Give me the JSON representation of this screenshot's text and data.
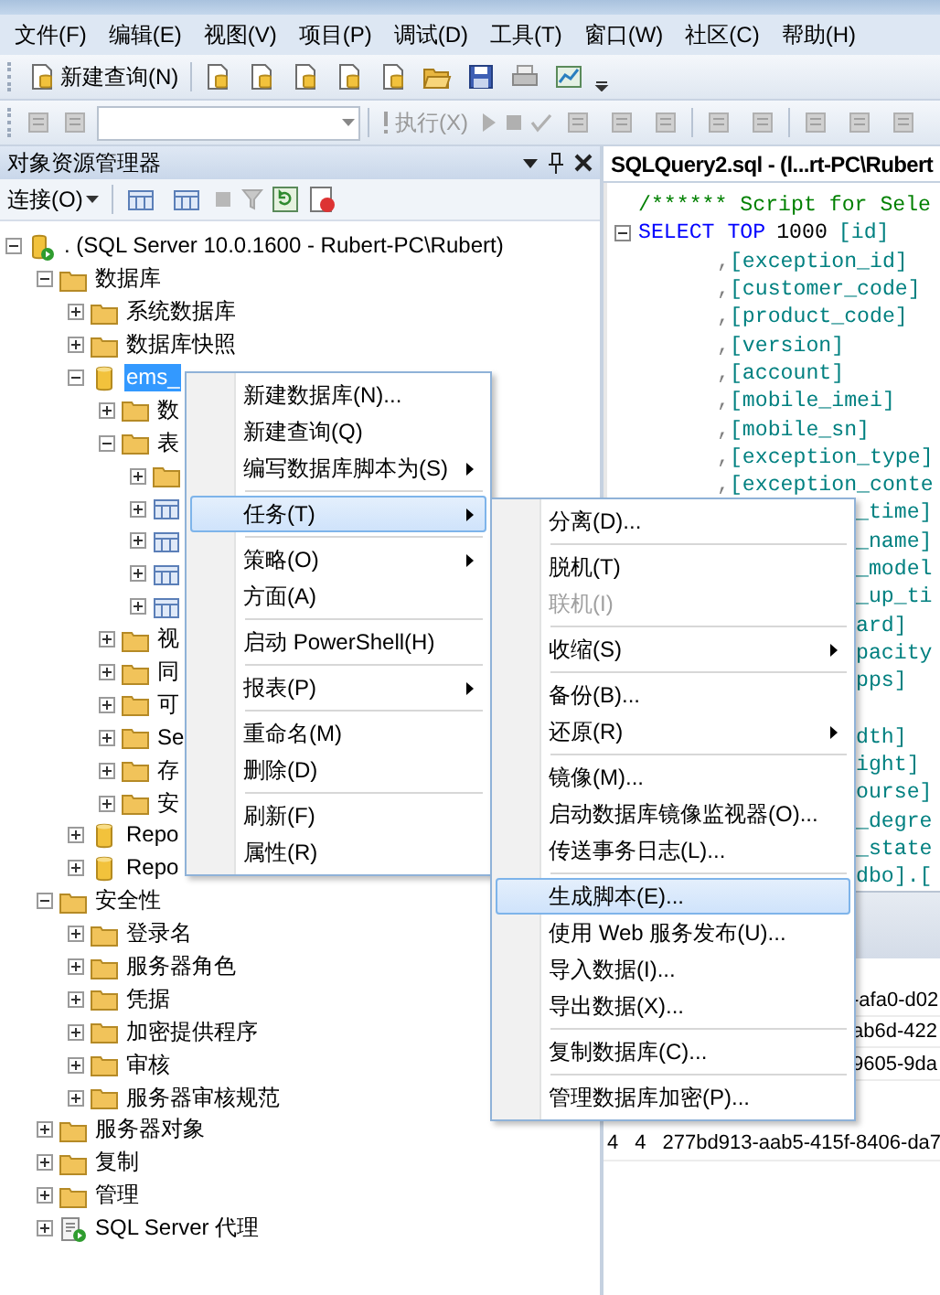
{
  "menu_bar": [
    "文件(F)",
    "编辑(E)",
    "视图(V)",
    "项目(P)",
    "调试(D)",
    "工具(T)",
    "窗口(W)",
    "社区(C)",
    "帮助(H)"
  ],
  "toolbar": {
    "new_query": "新建查询(N)"
  },
  "query_toolbar": {
    "execute": "执行(X)"
  },
  "object_explorer": {
    "title": "对象资源管理器",
    "connect": "连接(O)",
    "tree": [
      {
        "label": ". (SQL Server 10.0.1600 - Rubert-PC\\Rubert)",
        "kind": "server",
        "expanded": true,
        "selected": false,
        "children": [
          {
            "label": "数据库",
            "kind": "folder",
            "expanded": true,
            "selected": false,
            "children": [
              {
                "label": "系统数据库",
                "kind": "folder",
                "expanded": false,
                "selected": false
              },
              {
                "label": "数据库快照",
                "kind": "folder",
                "expanded": false,
                "selected": false
              },
              {
                "label": "ems_",
                "kind": "database",
                "expanded": true,
                "selected": true,
                "children": [
                  {
                    "label": "数",
                    "kind": "folder",
                    "expanded": false,
                    "selected": false
                  },
                  {
                    "label": "表",
                    "kind": "folder",
                    "expanded": true,
                    "selected": false,
                    "children": [
                      {
                        "kind": "folder",
                        "expanded": false
                      },
                      {
                        "kind": "table",
                        "expanded": false
                      },
                      {
                        "kind": "table",
                        "expanded": false
                      },
                      {
                        "kind": "table",
                        "expanded": false
                      },
                      {
                        "kind": "table",
                        "expanded": false
                      }
                    ]
                  },
                  {
                    "label": "视",
                    "kind": "folder",
                    "expanded": false,
                    "selected": false
                  },
                  {
                    "label": "同",
                    "kind": "folder",
                    "expanded": false,
                    "selected": false
                  },
                  {
                    "label": "可",
                    "kind": "folder",
                    "expanded": false,
                    "selected": false
                  },
                  {
                    "label": "Se",
                    "kind": "folder",
                    "expanded": false,
                    "selected": false
                  },
                  {
                    "label": "存",
                    "kind": "folder",
                    "expanded": false,
                    "selected": false
                  },
                  {
                    "label": "安",
                    "kind": "folder",
                    "expanded": false,
                    "selected": false
                  }
                ]
              },
              {
                "label": "Repo",
                "kind": "database",
                "expanded": false,
                "selected": false
              },
              {
                "label": "Repo",
                "kind": "database",
                "expanded": false,
                "selected": false
              }
            ]
          },
          {
            "label": "安全性",
            "kind": "folder",
            "expanded": true,
            "selected": false,
            "children": [
              {
                "label": "登录名",
                "kind": "folder",
                "expanded": false,
                "selected": false
              },
              {
                "label": "服务器角色",
                "kind": "folder",
                "expanded": false,
                "selected": false
              },
              {
                "label": "凭据",
                "kind": "folder",
                "expanded": false,
                "selected": false
              },
              {
                "label": "加密提供程序",
                "kind": "folder",
                "expanded": false,
                "selected": false
              },
              {
                "label": "审核",
                "kind": "folder",
                "expanded": false,
                "selected": false
              },
              {
                "label": "服务器审核规范",
                "kind": "folder",
                "expanded": false,
                "selected": false
              }
            ]
          },
          {
            "label": "服务器对象",
            "kind": "folder",
            "expanded": false,
            "selected": false
          },
          {
            "label": "复制",
            "kind": "folder",
            "expanded": false,
            "selected": false
          },
          {
            "label": "管理",
            "kind": "folder",
            "expanded": false,
            "selected": false
          },
          {
            "label": "SQL Server 代理",
            "kind": "agent",
            "expanded": false,
            "selected": false
          }
        ]
      }
    ]
  },
  "editor": {
    "tab": "SQLQuery2.sql - (l...rt-PC\\Rubert",
    "lines": [
      {
        "kind": "full",
        "segments": [
          {
            "kind": "comment",
            "text": "/****** Script for Sele"
          }
        ]
      },
      {
        "kind": "fold",
        "segments": [
          {
            "kind": "keyword",
            "text": "SELECT TOP"
          },
          {
            "kind": "number",
            "text": "1000"
          },
          {
            "kind": "ident",
            "text": "[id]"
          }
        ]
      },
      {
        "kind": "column",
        "segments": [
          {
            "kind": "punct",
            "text": ","
          },
          {
            "kind": "ident",
            "text": "[exception_id]"
          }
        ]
      },
      {
        "kind": "column",
        "segments": [
          {
            "kind": "punct",
            "text": ","
          },
          {
            "kind": "ident",
            "text": "[customer_code]"
          }
        ]
      },
      {
        "kind": "column",
        "segments": [
          {
            "kind": "punct",
            "text": ","
          },
          {
            "kind": "ident",
            "text": "[product_code]"
          }
        ]
      },
      {
        "kind": "column",
        "segments": [
          {
            "kind": "punct",
            "text": ","
          },
          {
            "kind": "ident",
            "text": "[version]"
          }
        ]
      },
      {
        "kind": "column",
        "segments": [
          {
            "kind": "punct",
            "text": ","
          },
          {
            "kind": "ident",
            "text": "[account]"
          }
        ]
      },
      {
        "kind": "column",
        "segments": [
          {
            "kind": "punct",
            "text": ","
          },
          {
            "kind": "ident",
            "text": "[mobile_imei]"
          }
        ]
      },
      {
        "kind": "column",
        "segments": [
          {
            "kind": "punct",
            "text": ","
          },
          {
            "kind": "ident",
            "text": "[mobile_sn]"
          }
        ]
      },
      {
        "kind": "column",
        "segments": [
          {
            "kind": "punct",
            "text": ","
          },
          {
            "kind": "ident",
            "text": "[exception_type]"
          }
        ]
      },
      {
        "kind": "column",
        "segments": [
          {
            "kind": "punct",
            "text": ","
          },
          {
            "kind": "ident",
            "text": "[exception_conte"
          }
        ]
      },
      {
        "kind": "covered",
        "segments": [
          {
            "kind": "ident",
            "text": "_time]"
          }
        ]
      },
      {
        "kind": "covered",
        "segments": [
          {
            "kind": "ident",
            "text": "_name]"
          }
        ]
      },
      {
        "kind": "covered",
        "segments": [
          {
            "kind": "ident",
            "text": "_model"
          }
        ]
      },
      {
        "kind": "covered",
        "segments": [
          {
            "kind": "ident",
            "text": "_up_ti"
          }
        ]
      },
      {
        "kind": "covered",
        "segments": [
          {
            "kind": "ident",
            "text": "ard]"
          }
        ]
      },
      {
        "kind": "covered",
        "segments": [
          {
            "kind": "ident",
            "text": "pacity"
          }
        ]
      },
      {
        "kind": "covered",
        "segments": [
          {
            "kind": "ident",
            "text": "pps]"
          }
        ]
      },
      {
        "kind": "blank"
      },
      {
        "kind": "covered",
        "segments": [
          {
            "kind": "ident",
            "text": "dth]"
          }
        ]
      },
      {
        "kind": "covered",
        "segments": [
          {
            "kind": "ident",
            "text": "ight]"
          }
        ]
      },
      {
        "kind": "covered",
        "segments": [
          {
            "kind": "ident",
            "text": "ourse]"
          }
        ]
      },
      {
        "kind": "covered",
        "segments": [
          {
            "kind": "ident",
            "text": "_degre"
          }
        ]
      },
      {
        "kind": "covered",
        "segments": [
          {
            "kind": "ident",
            "text": "_state"
          }
        ]
      },
      {
        "kind": "covered",
        "segments": [
          {
            "kind": "ident",
            "text": "dbo].["
          }
        ]
      }
    ]
  },
  "results": {
    "rows": [
      {
        "kind": "covered",
        "cells": [
          "-afa0-d02"
        ]
      },
      {
        "kind": "covered",
        "cells": [
          "ab6d-422"
        ]
      },
      {
        "kind": "covered",
        "cells": [
          "9605-9da"
        ]
      },
      {
        "kind": "full",
        "cells": [
          "4",
          "4",
          "277bd913-aab5-415f-8406-da7"
        ]
      }
    ]
  },
  "context_menu": {
    "items": [
      {
        "kind": "item",
        "label": "新建数据库(N)...",
        "submenu": false,
        "selected": false,
        "disabled": false
      },
      {
        "kind": "item",
        "label": "新建查询(Q)",
        "submenu": false,
        "selected": false,
        "disabled": false
      },
      {
        "kind": "item",
        "label": "编写数据库脚本为(S)",
        "submenu": true,
        "selected": false,
        "disabled": false
      },
      {
        "kind": "separator"
      },
      {
        "kind": "item",
        "label": "任务(T)",
        "submenu": true,
        "selected": true,
        "disabled": false
      },
      {
        "kind": "separator"
      },
      {
        "kind": "item",
        "label": "策略(O)",
        "submenu": true,
        "selected": false,
        "disabled": false
      },
      {
        "kind": "item",
        "label": "方面(A)",
        "submenu": false,
        "selected": false,
        "disabled": false
      },
      {
        "kind": "separator"
      },
      {
        "kind": "item",
        "label": "启动 PowerShell(H)",
        "submenu": false,
        "selected": false,
        "disabled": false
      },
      {
        "kind": "separator"
      },
      {
        "kind": "item",
        "label": "报表(P)",
        "submenu": true,
        "selected": false,
        "disabled": false
      },
      {
        "kind": "separator"
      },
      {
        "kind": "item",
        "label": "重命名(M)",
        "submenu": false,
        "selected": false,
        "disabled": false
      },
      {
        "kind": "item",
        "label": "删除(D)",
        "submenu": false,
        "selected": false,
        "disabled": false
      },
      {
        "kind": "separator"
      },
      {
        "kind": "item",
        "label": "刷新(F)",
        "submenu": false,
        "selected": false,
        "disabled": false
      },
      {
        "kind": "item",
        "label": "属性(R)",
        "submenu": false,
        "selected": false,
        "disabled": false
      }
    ]
  },
  "tasks_submenu": {
    "items": [
      {
        "kind": "item",
        "label": "分离(D)...",
        "submenu": false,
        "selected": false,
        "disabled": false
      },
      {
        "kind": "separator"
      },
      {
        "kind": "item",
        "label": "脱机(T)",
        "submenu": false,
        "selected": false,
        "disabled": false
      },
      {
        "kind": "item",
        "label": "联机(I)",
        "submenu": false,
        "selected": false,
        "disabled": true
      },
      {
        "kind": "separator"
      },
      {
        "kind": "item",
        "label": "收缩(S)",
        "submenu": true,
        "selected": false,
        "disabled": false
      },
      {
        "kind": "separator"
      },
      {
        "kind": "item",
        "label": "备份(B)...",
        "submenu": false,
        "selected": false,
        "disabled": false
      },
      {
        "kind": "item",
        "label": "还原(R)",
        "submenu": true,
        "selected": false,
        "disabled": false
      },
      {
        "kind": "separator"
      },
      {
        "kind": "item",
        "label": "镜像(M)...",
        "submenu": false,
        "selected": false,
        "disabled": false
      },
      {
        "kind": "item",
        "label": "启动数据库镜像监视器(O)...",
        "submenu": false,
        "selected": false,
        "disabled": false
      },
      {
        "kind": "item",
        "label": "传送事务日志(L)...",
        "submenu": false,
        "selected": false,
        "disabled": false
      },
      {
        "kind": "separator"
      },
      {
        "kind": "item",
        "label": "生成脚本(E)...",
        "submenu": false,
        "selected": true,
        "disabled": false
      },
      {
        "kind": "item",
        "label": "使用 Web 服务发布(U)...",
        "submenu": false,
        "selected": false,
        "disabled": false
      },
      {
        "kind": "item",
        "label": "导入数据(I)...",
        "submenu": false,
        "selected": false,
        "disabled": false
      },
      {
        "kind": "item",
        "label": "导出数据(X)...",
        "submenu": false,
        "selected": false,
        "disabled": false
      },
      {
        "kind": "separator"
      },
      {
        "kind": "item",
        "label": "复制数据库(C)...",
        "submenu": false,
        "selected": false,
        "disabled": false
      },
      {
        "kind": "separator"
      },
      {
        "kind": "item",
        "label": "管理数据库加密(P)...",
        "submenu": false,
        "selected": false,
        "disabled": false
      }
    ]
  }
}
